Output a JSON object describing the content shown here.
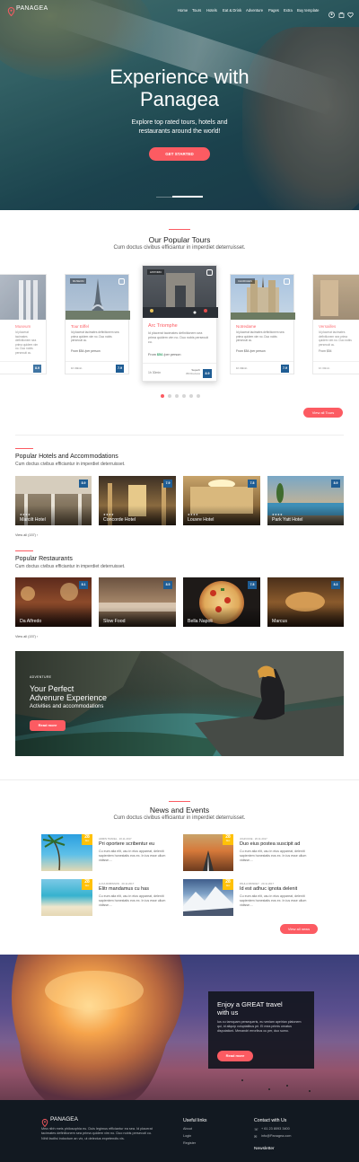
{
  "brand": {
    "name": "PANAGEA"
  },
  "nav": {
    "items": [
      "Home",
      "Tours",
      "Hotels",
      "Eat & Drink",
      "Adventure",
      "Pages",
      "Extra",
      "Buy template"
    ]
  },
  "hero": {
    "title_line1": "Experience with",
    "title_line2": "Panagea",
    "subtitle_line1": "Explore top rated tours, hotels and",
    "subtitle_line2": "restaurants around the world!",
    "cta": "GET STARTED"
  },
  "tours": {
    "title": "Our Popular Tours",
    "subtitle": "Cum doctus civibus efficiantur in imperdiet deterruisset.",
    "desc": "Id placerat tacimates definitionem sea prima quidem vim no. Duo nobis persecuti cu.",
    "items": [
      {
        "name": "Museum",
        "tag": "",
        "price": "",
        "score": "8.9"
      },
      {
        "name": "Tour Eiffel",
        "tag": "MUSEUM",
        "price": "From $54 /per person",
        "score": "7.9",
        "duration": "1h 30min"
      },
      {
        "name": "Arc Triomphe",
        "tag": "HISTORIC",
        "price_prefix": "From",
        "price": "$54",
        "price_suffix": "/per person",
        "score": "8.9",
        "duration": "1h 30min",
        "rating_label": "Superb",
        "reviews": "350 Reviews"
      },
      {
        "name": "Notredame",
        "tag": "CHURCHES",
        "price": "From $54 /per person",
        "score": "7.9",
        "duration": "1h 30min"
      },
      {
        "name": "Versailles",
        "tag": "",
        "price": "From $54",
        "score": "",
        "duration": "1h 30min"
      }
    ],
    "view_all": "View all Tours"
  },
  "hotels": {
    "title": "Popular Hotels and Accommodations",
    "subtitle": "Cum doctus civibus efficiantur in imperdiet deterruisset.",
    "items": [
      {
        "name": "Marcilt Hotel",
        "score": "8.9"
      },
      {
        "name": "Concorde Hotel",
        "score": "7.9"
      },
      {
        "name": "Louvre Hotel",
        "score": "7.8"
      },
      {
        "name": "Park Yatt Hotel",
        "score": "8.9"
      }
    ],
    "stars": "★★★★",
    "view_all": "View all (157) ›"
  },
  "restaurants": {
    "title": "Popular Restaurants",
    "subtitle": "Cum doctus civibus efficiantur in imperdiet deterruisset.",
    "items": [
      {
        "name": "Da Alfredo",
        "score": "8.1"
      },
      {
        "name": "Slow Food",
        "score": "8.5"
      },
      {
        "name": "Bella Napoli",
        "score": "7.8"
      },
      {
        "name": "Marcus",
        "score": "8.3"
      }
    ],
    "view_all": "View all (157) ›"
  },
  "adventure": {
    "tag": "ADVENTURE",
    "title_line1": "Your Perfect",
    "title_line2": "Advenure Experience",
    "subtitle": "Activities and accommodations",
    "cta": "Read more"
  },
  "news": {
    "title": "News and Events",
    "subtitle": "Cum doctus civibus efficiantur in imperdiet deterruisset.",
    "text": "Cu eum alia elit, usu in eius appareat, deleniti sapientem honestatis eos ex. In ius esse ullum vidisse....",
    "items": [
      {
        "meta": "ADMIN   TRAVEL   ·   20.11.2017",
        "title": "Pri oportere scribentur eu",
        "day": "28",
        "month": "Dec"
      },
      {
        "meta": "JOHN DOE   ·   20.11.2017",
        "title": "Duo eius postea suscipit ad",
        "day": "28",
        "month": "Dec"
      },
      {
        "meta": "LUCA ROBINSON   ·   20.11.2017",
        "title": "Elitr mandamus cu has",
        "day": "28",
        "month": "Dec"
      },
      {
        "meta": "PAULA RINSKEY   ·   20.11.2017",
        "title": "Id est adhuc ignota delenit",
        "day": "28",
        "month": "Dec"
      }
    ],
    "view_all": "View all news"
  },
  "lantern": {
    "title_line1": "Enjoy a GREAT travel",
    "title_line2": "with us",
    "text": "Ius cu tamquam persequeris, eu veniam apeirian platonem qui, id aliquip voluptatibus pri. Ei mea primis ornatus disputationi. Menandri erroribus cu per, duo sumo.",
    "cta": "Read more"
  },
  "footer": {
    "text": "Mea nibh meis philosophia eu. Duis legimus efficiantur ea sea. Id placerat tacimates definitionem sea prima quidem vim no. Duo nobis persecuti cu. Nihil facilisi indoctum an vix, ut delectus expetendis vis.",
    "links_title": "Useful links",
    "links": [
      "About",
      "Login",
      "Register"
    ],
    "contact_title": "Contact with Us",
    "phone": "+ 61 23 8093 3400",
    "email": "info@Panagea.com",
    "newsletter": "Newsletter"
  }
}
